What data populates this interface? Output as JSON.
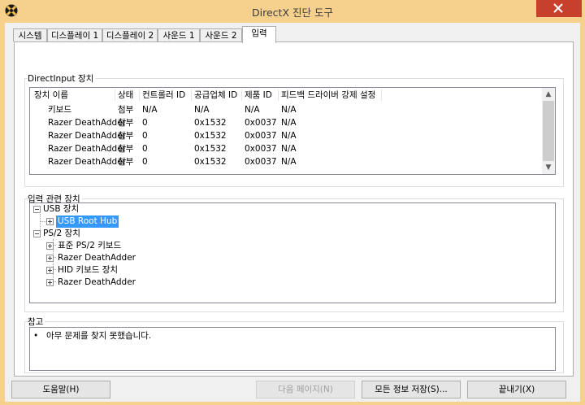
{
  "window": {
    "title": "DirectX 진단 도구"
  },
  "tabs": [
    {
      "label": "시스템"
    },
    {
      "label": "디스플레이 1"
    },
    {
      "label": "디스플레이 2"
    },
    {
      "label": "사운드 1"
    },
    {
      "label": "사운드 2"
    },
    {
      "label": "입력"
    }
  ],
  "directinput": {
    "title": "DirectInput 장치",
    "headers": [
      "장치 이름",
      "상태",
      "컨트롤러 ID",
      "공급업체 ID",
      "제품 ID",
      "피드백 드라이버 강제 설정"
    ],
    "rows": [
      [
        "키보드",
        "첨부",
        "N/A",
        "N/A",
        "N/A",
        "N/A"
      ],
      [
        "Razer DeathAdder",
        "첨부",
        "0",
        "0x1532",
        "0x0037",
        "N/A"
      ],
      [
        "Razer DeathAdder",
        "첨부",
        "0",
        "0x1532",
        "0x0037",
        "N/A"
      ],
      [
        "Razer DeathAdder",
        "첨부",
        "0",
        "0x1532",
        "0x0037",
        "N/A"
      ],
      [
        "Razer DeathAdder",
        "첨부",
        "0",
        "0x1532",
        "0x0037",
        "N/A"
      ]
    ]
  },
  "input_related": {
    "title": "입력 관련 장치",
    "tree": {
      "usb": {
        "label": "USB 장치",
        "children": [
          "USB Root Hub"
        ]
      },
      "ps2": {
        "label": "PS/2 장치",
        "children": [
          "표준 PS/2 키보드",
          "Razer DeathAdder",
          "HID 키보드 장치",
          "Razer DeathAdder"
        ]
      }
    }
  },
  "notes": {
    "title": "참고",
    "items": [
      "아무 문제를 찾지 못했습니다."
    ]
  },
  "buttons": {
    "help": "도움말(H)",
    "next_page": "다음 페이지(N)",
    "save_all": "모든 정보 저장(S)...",
    "exit": "끝내기(X)"
  },
  "colors": {
    "titlebar": "#f6d18e",
    "close": "#c7402b",
    "selection": "#3399ff"
  }
}
